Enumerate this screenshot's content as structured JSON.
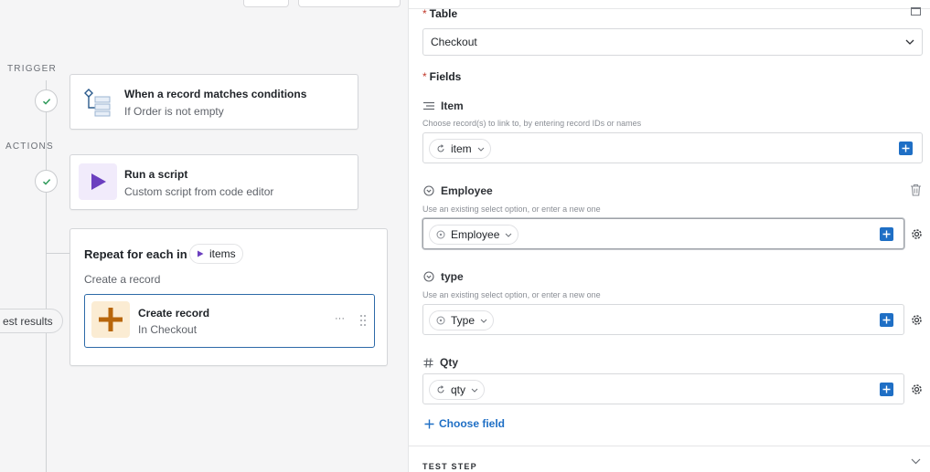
{
  "canvas": {
    "trigger_label": "TRIGGER",
    "actions_label": "ACTIONS",
    "trigger_card": {
      "title": "When a record matches conditions",
      "subtitle": "If Order is not empty",
      "icon": "conditions-icon"
    },
    "script_card": {
      "title": "Run a script",
      "subtitle": "Custom script from code editor",
      "icon": "play-icon",
      "accent": "#6b3fbf"
    },
    "repeat": {
      "title": "Repeat for each in",
      "chip_label": "items",
      "subtitle": "Create a record",
      "inner_card": {
        "title": "Create record",
        "subtitle": "In Checkout",
        "icon": "plus-icon",
        "accent": "#b8660b",
        "more": "···"
      }
    },
    "test_results_label": "est results"
  },
  "panel": {
    "table_label": "Table",
    "table_value": "Checkout",
    "fields_label": "Fields",
    "fields": [
      {
        "name": "Item",
        "icon": "link-field-icon",
        "hint": "Choose record(s) to link to, by entering record IDs or names",
        "token": "item",
        "token_icon": "refresh-icon"
      },
      {
        "name": "Employee",
        "icon": "select-field-icon",
        "hint": "Use an existing select option, or enter a new one",
        "token": "Employee",
        "token_icon": "clock-icon"
      },
      {
        "name": "type",
        "icon": "select-field-icon",
        "hint": "Use an existing select option, or enter a new one",
        "token": "Type",
        "token_icon": "clock-icon"
      },
      {
        "name": "Qty",
        "icon": "number-field-icon",
        "hint": "",
        "token": "qty",
        "token_icon": "refresh-icon"
      }
    ],
    "choose_field_label": "Choose field",
    "test_step_label": "TEST STEP"
  },
  "colors": {
    "accent_blue": "#1f6fc5",
    "required_star": "#c0392b",
    "script_purple": "#6b3fbf",
    "create_orange": "#b8660b"
  }
}
